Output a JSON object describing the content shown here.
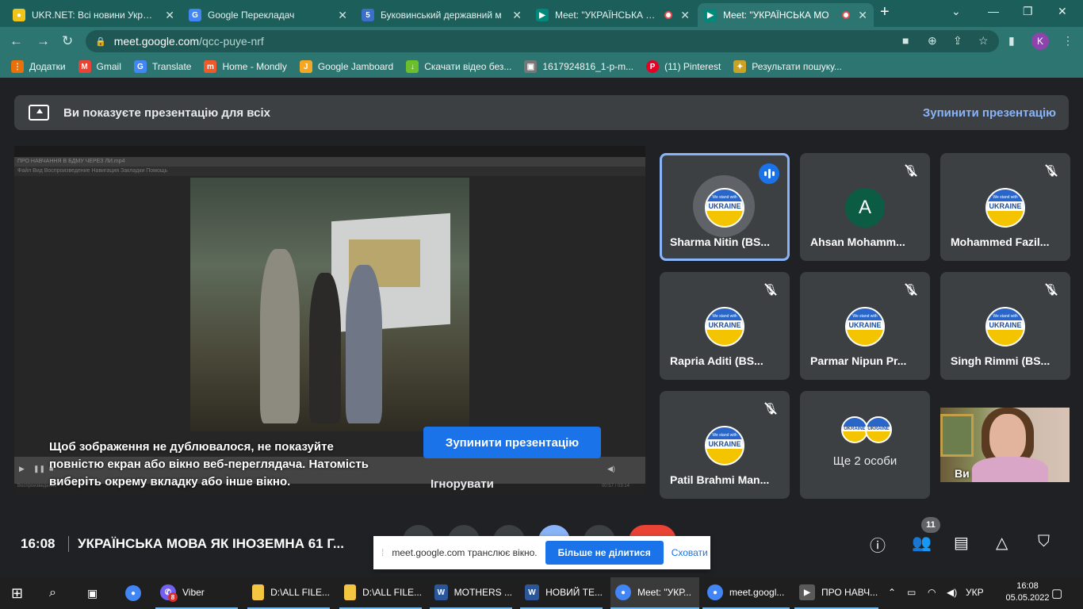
{
  "browser": {
    "tabs": [
      {
        "label": "UKR.NET: Всі новини України",
        "favicon": "ukrnet-icon",
        "color": "#f0c419"
      },
      {
        "label": "Google Перекладач",
        "favicon": "translate-icon",
        "color": "#4285f4"
      },
      {
        "label": "Буковинський державний м",
        "favicon": "university-icon",
        "color": "#3b6fc9"
      },
      {
        "label": "Meet: \"УКРАЇНСЬКА МО",
        "favicon": "meet-icon",
        "color": "#00897b"
      },
      {
        "label": "Meet: \"УКРАЇНСЬКА МО",
        "favicon": "meet-icon",
        "color": "#00897b"
      }
    ],
    "new_tab": "+",
    "url_host": "meet.google.com",
    "url_path": "/qcc-puye-nrf",
    "profile_initial": "K",
    "bookmarks": [
      {
        "label": "Додатки",
        "icon": "apps-grid-icon",
        "color": "#e8710a"
      },
      {
        "label": "Gmail",
        "icon": "gmail-icon",
        "color": "#ea4335"
      },
      {
        "label": "Translate",
        "icon": "translate-icon",
        "color": "#4285f4"
      },
      {
        "label": "Home - Mondly",
        "icon": "mondly-icon",
        "color": "#f05a28"
      },
      {
        "label": "Google Jamboard",
        "icon": "jamboard-icon",
        "color": "#f5a623"
      },
      {
        "label": "Скачати відео без...",
        "icon": "download-arrow-icon",
        "color": "#6abf2a"
      },
      {
        "label": "1617924816_1-p-m...",
        "icon": "image-icon",
        "color": "#777777"
      },
      {
        "label": "(11) Pinterest",
        "icon": "pinterest-icon",
        "color": "#e60023"
      },
      {
        "label": "Результати пошуку...",
        "icon": "emblem-icon",
        "color": "#c9a227"
      }
    ]
  },
  "meet": {
    "banner_text": "Ви показуєте презентацію для всіх",
    "banner_stop": "Зупинити презентацію",
    "warning_text": "Щоб зображення не дублювалося, не показуйте повністю екран або вікно веб-переглядача. Натомість виберіть окрему вкладку або інше вікно.",
    "stop_button": "Зупинити презентацію",
    "ignore_button": "Ігнорувати",
    "player_title": "ПРО НАВЧАННЯ В БДМУ ЧЕРЕЗ ЛИ.mp4",
    "player_menu": "Файл   Вид   Воспроизведение   Навигация   Закладки   Помощь",
    "player_time": "00:57 / 03:14",
    "player_status": "Воспроизведение",
    "ukraine_badge_top": "We stand with",
    "ukraine_badge_text": "UKRAINE",
    "participants": [
      {
        "name": "Sharma Nitin (BS...",
        "avatar": "ukraine"
      },
      {
        "name": "Ahsan Mohamm...",
        "avatar": "letter",
        "letter": "A"
      },
      {
        "name": "Mohammed Fazil...",
        "avatar": "ukraine"
      },
      {
        "name": "Rapria Aditi (BS...",
        "avatar": "ukraine"
      },
      {
        "name": "Parmar Nipun Pr...",
        "avatar": "ukraine"
      },
      {
        "name": "Singh Rimmi (BS...",
        "avatar": "ukraine"
      },
      {
        "name": "Patil Brahmi Man...",
        "avatar": "ukraine"
      }
    ],
    "more_people": "Ще 2 особи",
    "self_label": "Ви",
    "time": "16:08",
    "meeting_title": "УКРАЇНСЬКА МОВА ЯК ІНОЗЕМНА 61 Г...",
    "participants_count": "11"
  },
  "share_bar": {
    "grip": "⁞",
    "text": "meet.google.com транслює вікно.",
    "stop_button": "Більше не ділитися",
    "hide_button": "Сховати"
  },
  "taskbar": {
    "items": [
      {
        "label": "Viber",
        "icon": "viber-icon",
        "color": "#7360f2",
        "badge": "8"
      },
      {
        "label": "D:\\ALL FILE...",
        "icon": "folder-icon",
        "color": "#f4c542"
      },
      {
        "label": "D:\\ALL FILE...",
        "icon": "folder-icon",
        "color": "#f4c542"
      },
      {
        "label": "MOTHERS ...",
        "icon": "word-icon",
        "color": "#2b579a"
      },
      {
        "label": "НОВИЙ ТЕ...",
        "icon": "word-icon",
        "color": "#2b579a"
      },
      {
        "label": "Meet: \"УКР...",
        "icon": "chrome-icon",
        "color": "#4285f4"
      },
      {
        "label": "meet.googl...",
        "icon": "chrome-icon",
        "color": "#4285f4"
      },
      {
        "label": "ПРО НАВЧ...",
        "icon": "media-player-icon",
        "color": "#5a5a5a"
      }
    ],
    "language": "УКР",
    "clock_time": "16:08",
    "clock_date": "05.05.2022"
  }
}
